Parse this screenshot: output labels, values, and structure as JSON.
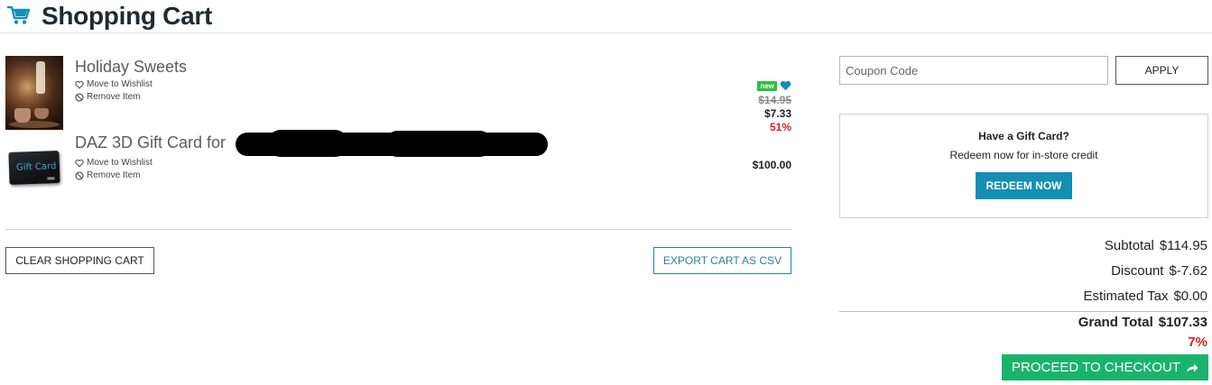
{
  "header": {
    "title": "Shopping Cart",
    "icon": "cart-icon"
  },
  "items": [
    {
      "name": "Holiday Sweets",
      "wishlist_label": "Move to Wishlist",
      "remove_label": "Remove Item",
      "badge": "new",
      "original_price": "$14.95",
      "price": "$7.33",
      "discount_percent": "51%"
    },
    {
      "name": "DAZ 3D Gift Card for",
      "thumbnail_text": "Gift Card",
      "wishlist_label": "Move to Wishlist",
      "remove_label": "Remove Item",
      "price": "$100.00"
    }
  ],
  "actions": {
    "clear_label": "CLEAR SHOPPING CART",
    "export_label": "EXPORT CART AS CSV"
  },
  "coupon": {
    "placeholder": "Coupon Code",
    "apply_label": "APPLY"
  },
  "gift_card": {
    "title": "Have a Gift Card?",
    "subtitle": "Redeem now for in-store credit",
    "button_label": "REDEEM NOW"
  },
  "summary": {
    "subtotal_label": "Subtotal",
    "subtotal_value": "$114.95",
    "discount_label": "Discount",
    "discount_value": "$-7.62",
    "tax_label": "Estimated Tax",
    "tax_value": "$0.00",
    "grand_label": "Grand Total",
    "grand_value": "$107.33",
    "savings_percent": "7%"
  },
  "checkout": {
    "label": "PROCEED TO CHECKOUT"
  },
  "colors": {
    "accent_teal": "#148eb3",
    "checkout_green": "#1ab36d",
    "discount_red": "#d0202a",
    "new_badge_green": "#2fbf3f"
  }
}
